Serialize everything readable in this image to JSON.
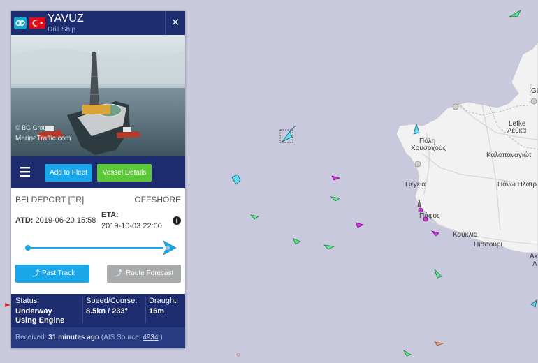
{
  "vessel": {
    "name": "YAVUZ",
    "type": "Drill Ship",
    "flag": "Turkey",
    "photo_credit_1": "© BG Group",
    "photo_credit_2": "MarineTraffic.com"
  },
  "toolbar": {
    "add_to_fleet": "Add to Fleet",
    "vessel_details": "Vessel Details"
  },
  "voyage": {
    "from": "BELDEPORT [TR]",
    "to": "OFFSHORE",
    "atd_label": "ATD:",
    "atd": "2019-06-20 15:58",
    "eta_label": "ETA:",
    "eta": "2019-10-03 22:00",
    "progress": 1.0
  },
  "actions": {
    "past_track": "Past Track",
    "route_forecast": "Route Forecast"
  },
  "stats": {
    "status_label": "Status:",
    "status_line1": "Underway",
    "status_line2": "Using Engine",
    "speed_label": "Speed/Course:",
    "speed": "8.5kn / 233°",
    "draught_label": "Draught:",
    "draught": "16m"
  },
  "footer": {
    "received_prefix": "Received: ",
    "received_time": "31 minutes ago",
    "ais_prefix": " (AIS Source: ",
    "ais_source": "4934",
    "ais_suffix": " )"
  },
  "map_labels": {
    "poli": "Πόλη",
    "chrysochous": "Χρυσοχούς",
    "lefke": "Lefke",
    "lefka": "Λεύκα",
    "kalopanagiotis": "Καλοπαναγιώτ",
    "pano_platres": "Πάνω Πλάτρ",
    "pegeia": "Πέγεια",
    "pafos": "Πάφος",
    "kouklia": "Κούκλια",
    "pissouri": "Πισσούρι",
    "edge_top": "Gü",
    "edge_right1": "Ακ",
    "edge_right2": "Λ"
  },
  "colors": {
    "sea": "#c8c9dd",
    "land": "#f2f2f2",
    "panel_navy": "#1c2c6e",
    "add_fleet_blue": "#1ba6ea",
    "vessel_details_green": "#5cc737",
    "route_gray": "#a9aaab",
    "ship_green": "#63e88f",
    "ship_magenta": "#d433d8",
    "ship_cyan": "#5fdcf0"
  }
}
